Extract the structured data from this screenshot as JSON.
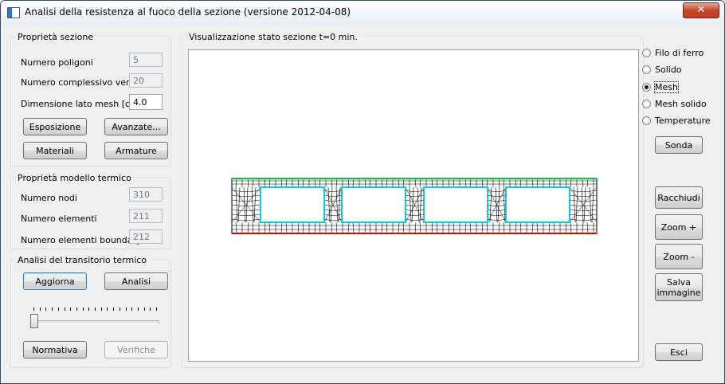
{
  "window": {
    "title": "Analisi della resistenza al fuoco della sezione (versione 2012-04-08)",
    "close_glyph": "✕"
  },
  "section_props": {
    "legend": "Proprietà sezione",
    "num_polygons_label": "Numero poligoni",
    "num_polygons": "5",
    "num_vertices_label": "Numero complessivo vertici",
    "num_vertices": "20",
    "mesh_size_label": "Dimensione lato mesh [cm]",
    "mesh_size": "4.0",
    "exposure_button": "Esposizione",
    "advanced_button": "Avanzate...",
    "materials_button": "Materiali",
    "rebars_button": "Armature"
  },
  "thermal_model": {
    "legend": "Proprietà modello termico",
    "num_nodes_label": "Numero nodi",
    "num_nodes": "310",
    "num_elements_label": "Numero elementi",
    "num_elements": "211",
    "num_boundary_label": "Numero elementi boundary",
    "num_boundary": "212"
  },
  "transient": {
    "legend": "Analisi del transitorio termico",
    "update_button": "Aggiorna",
    "analysis_button": "Analisi",
    "normative_button": "Normativa",
    "checks_button": "Verifiche",
    "time_slider_position": 0
  },
  "view": {
    "legend": "Visualizzazione stato sezione t=0 min."
  },
  "display_modes": {
    "options": [
      "Filo di ferro",
      "Solido",
      "Mesh",
      "Mesh solido",
      "Temperature"
    ],
    "selected_index": 2
  },
  "right_buttons": {
    "probe": "Sonda",
    "fit": "Racchiudi",
    "zoom_in": "Zoom +",
    "zoom_out": "Zoom -",
    "save_image": "Salva immagine",
    "exit": "Esci"
  },
  "colors": {
    "exposed_edge_top": "#00cc33",
    "exposed_edge_bottom": "#e00000",
    "void_outline": "#14c8d4",
    "mesh": "#000000"
  }
}
